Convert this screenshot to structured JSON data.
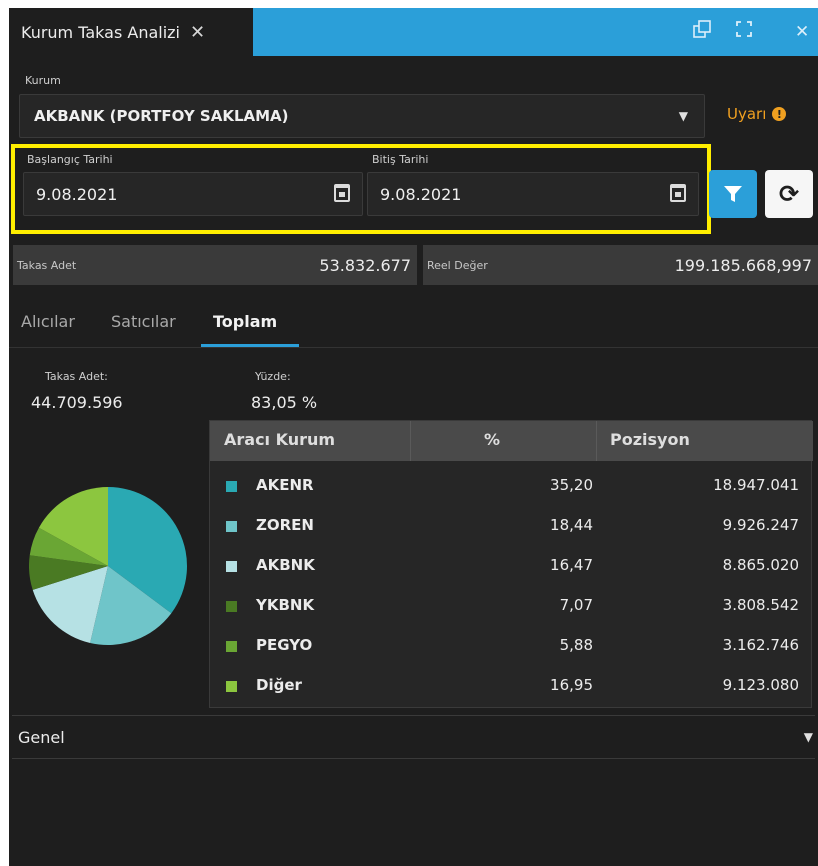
{
  "window": {
    "tab_title": "Kurum Takas Analizi",
    "close_glyph": "✕"
  },
  "form": {
    "kurum_label": "Kurum",
    "kurum_value": "AKBANK (PORTFOY SAKLAMA)",
    "uyari": "Uyarı",
    "start_label": "Başlangıç Tarihi",
    "start_value": "9.08.2021",
    "end_label": "Bitiş Tarihi",
    "end_value": "9.08.2021",
    "refresh_glyph": "⟳"
  },
  "stats": {
    "takas_adet_label": "Takas Adet",
    "takas_adet_value": "53.832.677",
    "reel_deger_label": "Reel Değer",
    "reel_deger_value": "199.185.668,997"
  },
  "tabs": [
    {
      "label": "Alıcılar",
      "active": false
    },
    {
      "label": "Satıcılar",
      "active": false
    },
    {
      "label": "Toplam",
      "active": true
    }
  ],
  "summary": {
    "takas_adet_label": "Takas Adet:",
    "takas_adet_value": "44.709.596",
    "yuzde_label": "Yüzde:",
    "yuzde_value": "83,05 %"
  },
  "table": {
    "headers": [
      "Aracı Kurum",
      "%",
      "Pozisyon"
    ],
    "rows": [
      {
        "name": "AKENR",
        "pct": "35,20",
        "pos": "18.947.041",
        "color": "#2aa9b3"
      },
      {
        "name": "ZOREN",
        "pct": "18,44",
        "pos": "9.926.247",
        "color": "#6fc5c9"
      },
      {
        "name": "AKBNK",
        "pct": "16,47",
        "pos": "8.865.020",
        "color": "#b6e1e4"
      },
      {
        "name": "YKBNK",
        "pct": "7,07",
        "pos": "3.808.542",
        "color": "#4a7a23"
      },
      {
        "name": "PEGYO",
        "pct": "5,88",
        "pos": "3.162.746",
        "color": "#6aa634"
      },
      {
        "name": "Diğer",
        "pct": "16,95",
        "pos": "9.123.080",
        "color": "#8cc63f"
      }
    ]
  },
  "footer": {
    "genel": "Genel"
  }
}
